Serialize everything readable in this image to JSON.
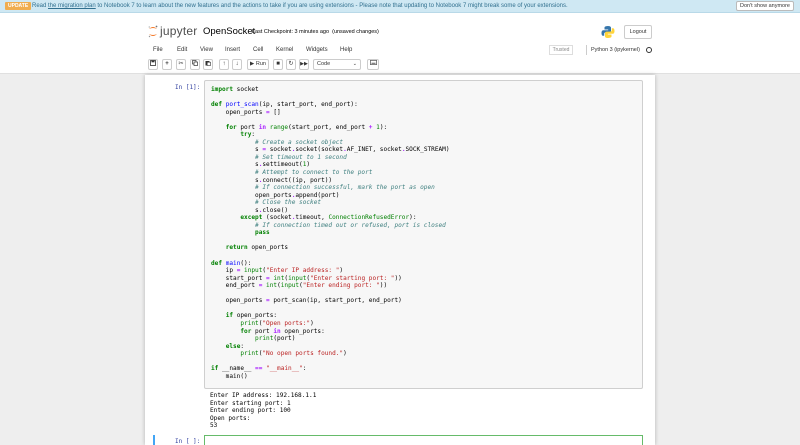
{
  "banner": {
    "badge": "UPDATE",
    "text_before": "Read ",
    "link": "the migration plan",
    "text_after": " to Notebook 7 to learn about the new features and the actions to take if you are using extensions - Please note that updating to Notebook 7 might break some of your extensions.",
    "dismiss": "Don't show anymore"
  },
  "header": {
    "logo_text": "jupyter",
    "title": "OpenSocket",
    "checkpoint": "Last Checkpoint: 3 minutes ago",
    "save_status": "(unsaved changes)",
    "logout": "Logout"
  },
  "menu": [
    "File",
    "Edit",
    "View",
    "Insert",
    "Cell",
    "Kernel",
    "Widgets",
    "Help"
  ],
  "trusted": "Trusted",
  "kernel": "Python 3 (ipykernel)",
  "toolbar": {
    "run": "Run",
    "cell_type": "Code"
  },
  "cell1": {
    "prompt": "In [1]:",
    "output": [
      "Enter IP address: 192.168.1.1",
      "Enter starting port: 1",
      "Enter ending port: 100",
      "Open ports:",
      "53"
    ]
  },
  "cell2": {
    "prompt": "In [ ]:"
  },
  "colors": {
    "banner_bg": "#cfe8f3",
    "badge": "#f0ad4e",
    "prompt_in": "#303f9f",
    "active_cell": "#42a5f5",
    "edit_border": "#66bb6a"
  }
}
